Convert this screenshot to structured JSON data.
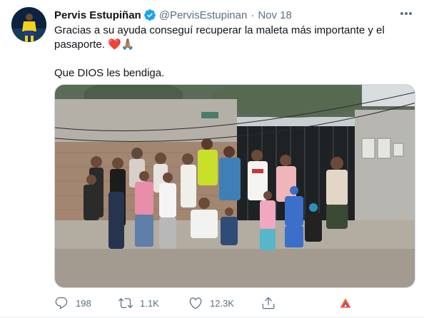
{
  "tweet": {
    "display_name": "Pervis Estupiñan",
    "handle": "@PervisEstupinan",
    "separator": "·",
    "date": "Nov 18",
    "text_line1": "Gracias a su ayuda conseguí recuperar la maleta más importante y el",
    "text_line2": "pasaporte.",
    "emojis": "❤️🙏🏽",
    "text_para2": "Que DIOS les bendiga.",
    "media_alt": "group photo",
    "icons": {
      "verified": "verified-badge-icon",
      "more": "more-icon",
      "reply": "reply-icon",
      "retweet": "retweet-icon",
      "like": "like-icon",
      "share": "share-icon",
      "analytics": "analytics-icon"
    },
    "colors": {
      "verified": "#1da1f2",
      "secondary_text": "#5b7083",
      "heart": "#e0245e",
      "analytics_orange": "#f45d22",
      "analytics_purple": "#794bc4"
    }
  },
  "actions": {
    "reply_count": "198",
    "retweet_count": "1.1K",
    "like_count": "12.3K"
  }
}
